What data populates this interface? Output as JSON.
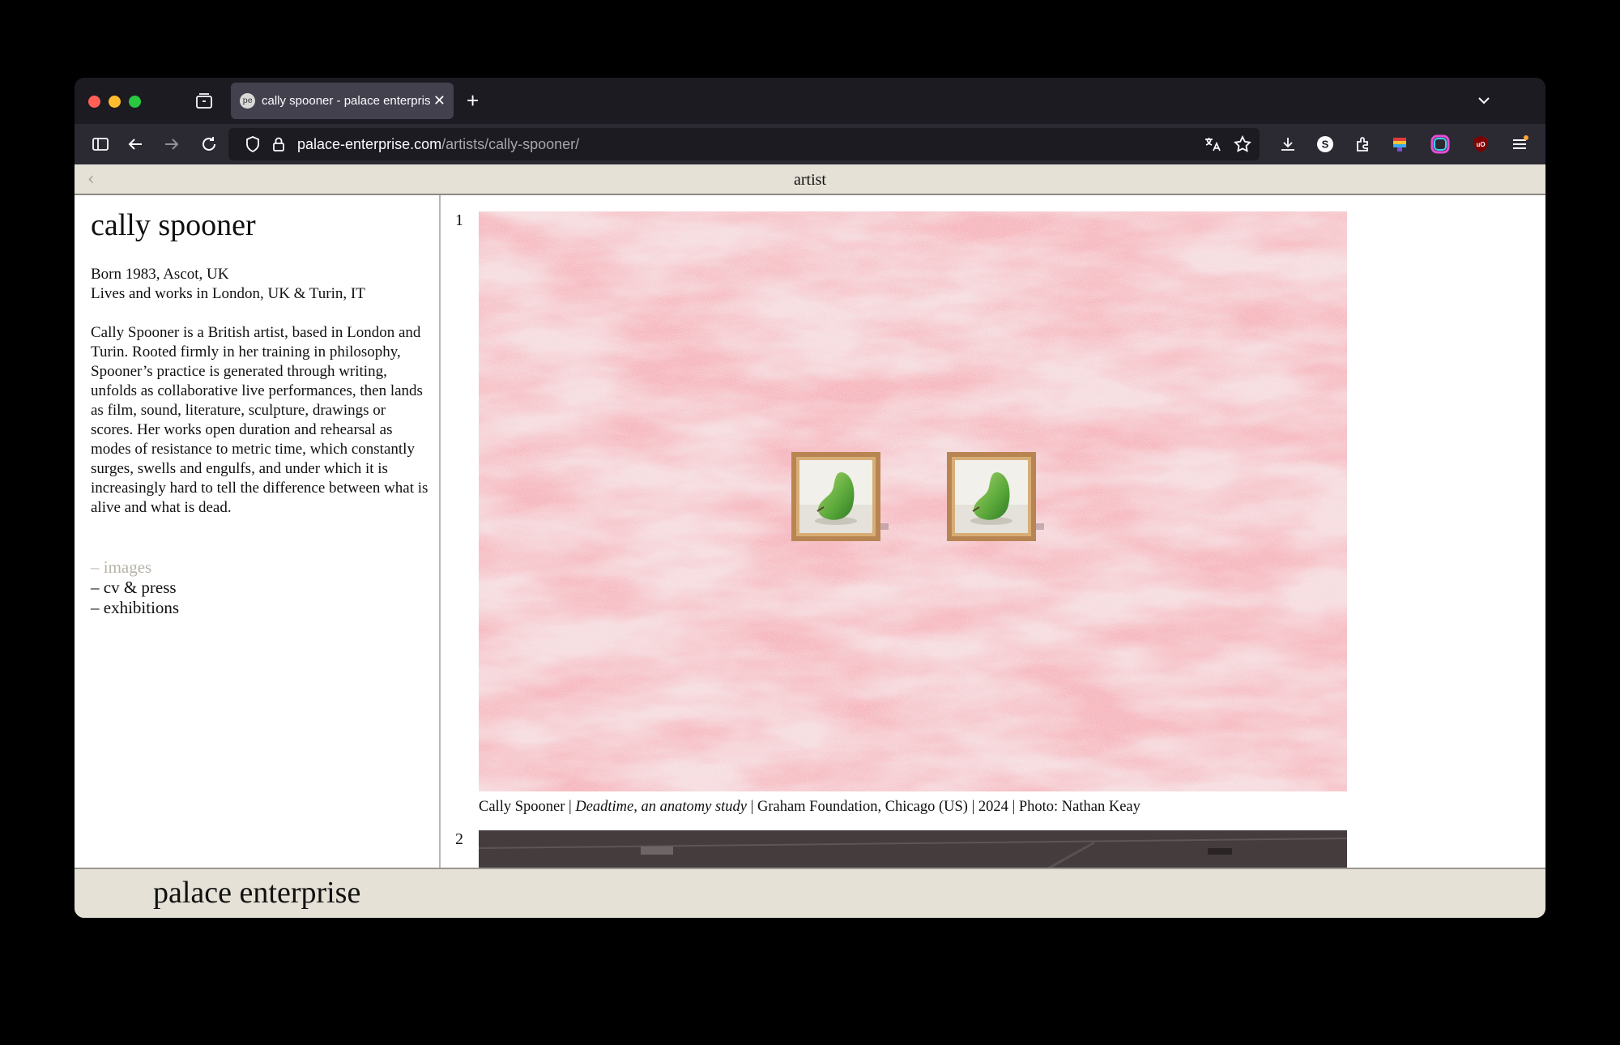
{
  "browser": {
    "tab_title": "cally spooner - palace enterprise",
    "favicon_text": "pe",
    "url_domain": "palace-enterprise.com",
    "url_path": "/artists/cally-spooner/"
  },
  "page": {
    "header_title": "artist",
    "artist": {
      "name": "cally spooner",
      "born": "Born 1983, Ascot, UK",
      "lives": "Lives and works in London, UK & Turin, IT",
      "bio": "Cally Spooner is a British artist, based in London and Turin. Rooted firmly in her training in philosophy, Spooner’s practice is generated through writing, unfolds as collaborative live performances, then lands as film, sound, literature, sculpture, drawings or scores. Her works open duration and rehearsal as modes of resistance to metric time, which constantly surges, swells and engulfs, and under which it is increasingly hard to tell the difference between what is alive and what is dead."
    },
    "links": [
      "– images",
      "– cv & press",
      "– exhibitions"
    ],
    "images": [
      {
        "number": "1",
        "caption_artist": "Cally Spooner | ",
        "caption_title": "Deadtime, an anatomy study",
        "caption_rest": " | Graham Foundation, Chicago (US) | 2024 | Photo: Nathan Keay"
      },
      {
        "number": "2"
      }
    ],
    "footer_logo": "palace enterprise"
  },
  "colors": {
    "header_bg": "#e5e1d6",
    "active_link": "#b8b3a8",
    "wall_pink": "#f0c3c6"
  }
}
